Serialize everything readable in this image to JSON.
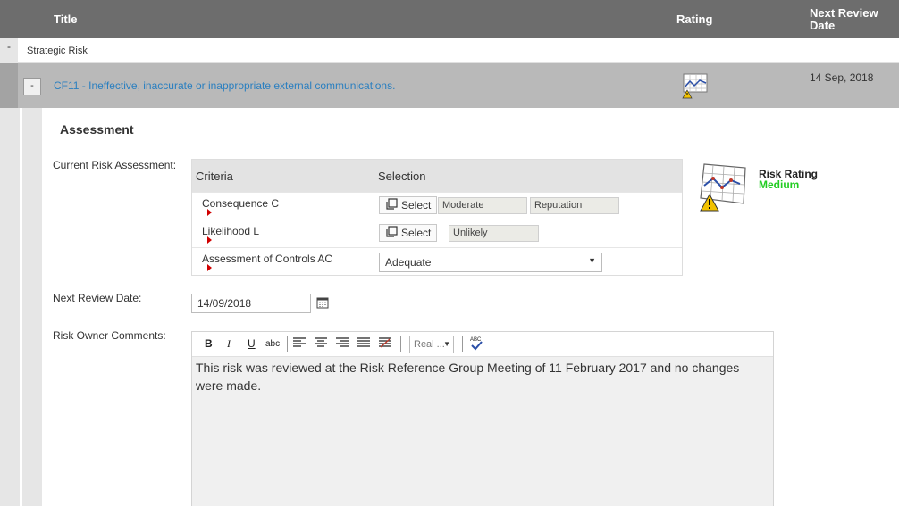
{
  "header": {
    "title_col": "Title",
    "rating_col": "Rating",
    "review_col": "Next Review Date"
  },
  "group": {
    "toggle": "-",
    "label": "Strategic Risk"
  },
  "risk": {
    "toggle": "-",
    "title": "CF11 - Ineffective, inaccurate or inappropriate external communications.",
    "next_review": "14 Sep, 2018",
    "rating_icon": "risk-chart-warning-icon"
  },
  "assessment": {
    "heading": "Assessment",
    "current_label": "Current Risk Assessment:",
    "table": {
      "col_criteria": "Criteria",
      "col_selection": "Selection",
      "rows": [
        {
          "name": "Consequence C",
          "select_label": "Select",
          "values": [
            "Moderate",
            "Reputation"
          ]
        },
        {
          "name": "Likelihood L",
          "select_label": "Select",
          "values": [
            "Unlikely"
          ]
        },
        {
          "name": "Assessment of Controls AC",
          "dropdown": "Adequate"
        }
      ]
    },
    "risk_rating": {
      "title": "Risk Rating",
      "value": "Medium",
      "value_color": "#22cc22"
    },
    "next_review_label": "Next Review Date:",
    "next_review_value": "14/09/2018",
    "comments_label": "Risk Owner Comments:",
    "editor": {
      "font_select": "Real ...",
      "body": "This risk was reviewed at the Risk Reference Group Meeting of 11 February 2017 and no changes were made."
    }
  },
  "colors": {
    "header_bg": "#6d6d6d",
    "risk_row_bg": "#b9b9b9",
    "link": "#2a7fc0"
  }
}
